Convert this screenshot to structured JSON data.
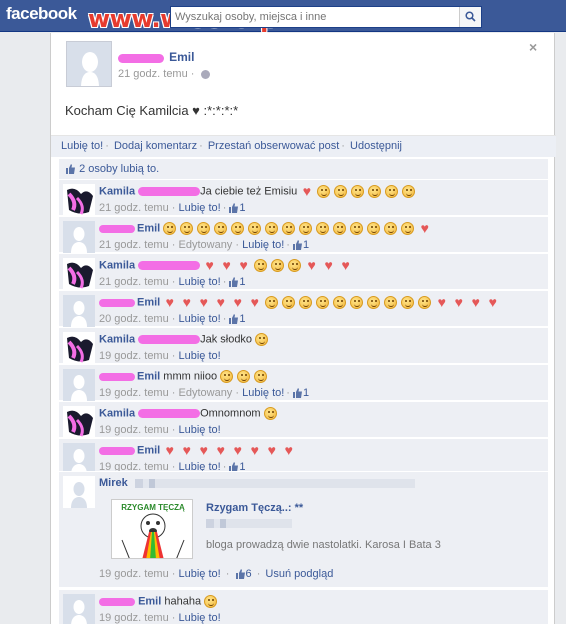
{
  "topbar": {
    "logo": "facebook",
    "watermark": "www.wiocha.pl",
    "search_placeholder": "Wyszukaj osoby, miejsca i inne"
  },
  "post": {
    "author": "Emil",
    "time": "21 godz. temu ·",
    "text": "Kocham Cię Kamilcia ♥ :*:*:*:*",
    "close": "×"
  },
  "actions": {
    "like": "Lubię to!",
    "comment": "Dodaj komentarz",
    "unfollow": "Przestań obserwować post",
    "share": "Udostępnij"
  },
  "likes_summary": "2 osoby lubią to.",
  "comments": [
    {
      "name": "Kamila",
      "text": "Ja ciebie też Emisiu",
      "emoji": [
        "heart",
        "smile",
        "smile",
        "smile",
        "smile",
        "smile",
        "smile"
      ],
      "time": "21 godz. temu ·",
      "edited": "",
      "like": "Lubię to!",
      "likes": "1"
    },
    {
      "name": "Emil",
      "text": "",
      "emoji": [
        "smile",
        "smile",
        "smile",
        "smile",
        "smile",
        "smile",
        "smile",
        "smile",
        "smile",
        "smile",
        "smile",
        "smile",
        "smile",
        "smile",
        "smile",
        "heart"
      ],
      "time": "21 godz. temu ·",
      "edited": "Edytowany ·",
      "like": "Lubię to!",
      "likes": "1"
    },
    {
      "name": "Kamila",
      "text": "",
      "emoji": [
        "heart",
        "heart",
        "heart",
        "smile",
        "smile",
        "smile",
        "heart",
        "heart",
        "heart"
      ],
      "time": "21 godz. temu ·",
      "edited": "",
      "like": "Lubię to!",
      "likes": "1"
    },
    {
      "name": "Emil",
      "text": "",
      "emoji": [
        "heart",
        "heart",
        "heart",
        "heart",
        "heart",
        "heart",
        "smile",
        "smile",
        "smile",
        "smile",
        "smile",
        "smile",
        "smile",
        "smile",
        "smile",
        "smile",
        "heart",
        "heart",
        "heart",
        "heart"
      ],
      "time": "20 godz. temu ·",
      "edited": "",
      "like": "Lubię to!",
      "likes": "1"
    },
    {
      "name": "Kamila",
      "text": "Jak słodko",
      "emoji": [
        "smile"
      ],
      "time": "19 godz. temu ·",
      "edited": "",
      "like": "Lubię to!",
      "likes": ""
    },
    {
      "name": "Emil",
      "text": "mmm niioo",
      "emoji": [
        "smile",
        "smile",
        "smile"
      ],
      "time": "19 godz. temu ·",
      "edited": "Edytowany ·",
      "like": "Lubię to!",
      "likes": "1"
    },
    {
      "name": "Kamila",
      "text": "Omnomnom",
      "emoji": [
        "smile"
      ],
      "time": "19 godz. temu ·",
      "edited": "",
      "like": "Lubię to!",
      "likes": ""
    },
    {
      "name": "Emil",
      "text": "",
      "emoji": [
        "heart",
        "heart",
        "heart",
        "heart",
        "heart",
        "heart",
        "heart",
        "heart"
      ],
      "time": "19 godz. temu ·",
      "edited": "",
      "like": "Lubię to!",
      "likes": "1"
    }
  ],
  "mirek_comment": {
    "name": "Mirek",
    "preview_title": "Rzygam Tęczą..: **",
    "preview_desc": "bloga prowadzą dwie nastolatki. Karosa I Bata 3",
    "thumb_caption": "RZYGAM TĘCZĄ",
    "time": "19 godz. temu ·",
    "like": "Lubię to!",
    "likes": "6",
    "remove_preview": "Usuń podgląd"
  },
  "last_comment": {
    "name": "Emil",
    "text": "hahaha",
    "time": "19 godz. temu ·",
    "like": "Lubię to!"
  },
  "colors": {
    "brand": "#3b5998",
    "pink_scribble": "#f36ee5",
    "heart": "#e55858"
  }
}
